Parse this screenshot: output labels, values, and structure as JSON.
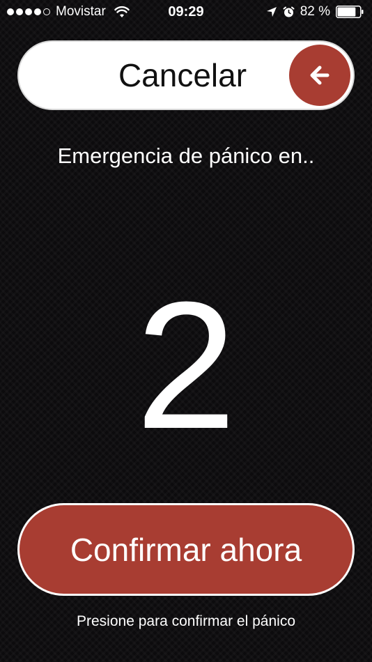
{
  "status_bar": {
    "carrier": "Movistar",
    "time": "09:29",
    "battery_percent": "82 %",
    "battery_level": 0.82,
    "signal_bars": 4,
    "signal_total": 5,
    "icons": [
      "signal-dots-icon",
      "wifi-icon",
      "location-arrow-icon",
      "alarm-icon",
      "battery-icon"
    ]
  },
  "cancel_slider": {
    "label": "Cancelar",
    "handle_icon": "arrow-left-icon"
  },
  "countdown": {
    "caption": "Emergencia de pánico en..",
    "value": "2"
  },
  "confirm": {
    "label": "Confirmar ahora",
    "hint": "Presione para confirmar el pánico"
  },
  "colors": {
    "accent": "#a83d32",
    "background": "#0c0b0d",
    "text": "#ffffff",
    "slider_background": "#ffffff",
    "slider_text": "#111111"
  }
}
